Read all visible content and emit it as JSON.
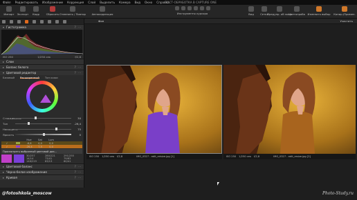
{
  "menubar": {
    "items": [
      "Файл",
      "Редактировать",
      "Изображение",
      "Коррекция",
      "Слой",
      "Выделить",
      "Камера",
      "Вид",
      "Окно",
      "Справка"
    ],
    "window_title": "ПОСТ-ОБРАБОТКА В CAPTURE ONE"
  },
  "toolbar": {
    "left": [
      {
        "label": "Импорт",
        "icon": "import-icon"
      },
      {
        "label": "Экспорт",
        "icon": "export-icon"
      },
      {
        "label": "Кадр",
        "icon": "camera-icon"
      },
      {
        "label": "Сбросить",
        "icon": "reset-icon"
      },
      {
        "label": "Отменить / Повтор",
        "icon": "undo-redo-icon"
      },
      {
        "label": "Автокоррекция",
        "icon": "auto-adjust-icon"
      }
    ],
    "center_label": "Инструменты курсора",
    "right": [
      {
        "label": "Вид",
        "icon": "view-icon"
      },
      {
        "label": "Сетка",
        "icon": "grid-icon"
      },
      {
        "label": "Предупр. об эксп.",
        "icon": "exposure-warning-icon"
      },
      {
        "label": "Цветопроба",
        "icon": "proof-icon"
      },
      {
        "label": "Изменить выбор",
        "icon": "edit-selection-icon"
      },
      {
        "label": "Копир./Примен.",
        "icon": "copy-apply-icon"
      }
    ]
  },
  "left_panel": {
    "histogram": {
      "title": "Гистограмма",
      "iso": "ISO 250",
      "shutter": "1/250 сек",
      "aperture": "f/2,8"
    },
    "sections_top": [
      "Слои",
      "Баланс белого",
      "Цветовой редактор"
    ],
    "color_editor_tabs": [
      "Базовый",
      "Расширенный",
      "Тон кожи"
    ],
    "sliders": [
      {
        "label": "Сглаживание",
        "value": "30"
      },
      {
        "label": "Тон",
        "value": "-26,4"
      },
      {
        "label": "Насыщенн.",
        "value": "75"
      },
      {
        "label": "Яркость",
        "value": "0"
      }
    ],
    "table_header": [
      "",
      "",
      "Hue",
      "Sat",
      "Lum"
    ],
    "table_rows": [
      [
        "✓",
        "",
        "-8,6",
        "0,0",
        "0,0"
      ],
      [
        "✓",
        "",
        "-26,4",
        "7,5",
        "0,0"
      ]
    ],
    "preview_label": "Просмотреть выбранный цветовой диа...",
    "swatch_values": [
      "30/257",
      "280/221",
      "291/255",
      "14/14",
      "73/41",
      "79/63",
      "148/219",
      "83/13",
      "60/41"
    ],
    "sections_bottom": [
      "Цветовой баланс",
      "Черно-белое изображение",
      "Кривая"
    ]
  },
  "viewer": {
    "selector": "Фон",
    "right_label": "Участить",
    "captions": [
      {
        "iso": "ISO 250",
        "shutter": "1/250 сек",
        "aperture": "f/2,8",
        "file": "IMG_0327 - edit_reisize.jpg [1]"
      },
      {
        "iso": "ISO 250",
        "shutter": "1/250 сек",
        "aperture": "f/2,8",
        "file": "IMG_0327 - edit_resize.jpg [2]"
      }
    ]
  },
  "footer": {
    "handle": "@fotoshkola_moscow",
    "watermark": "Photo-Study.ru"
  },
  "colors": {
    "accent": "#e06a1d",
    "dress_left": "#7a3fc8",
    "dress_right": "#a8641e"
  }
}
